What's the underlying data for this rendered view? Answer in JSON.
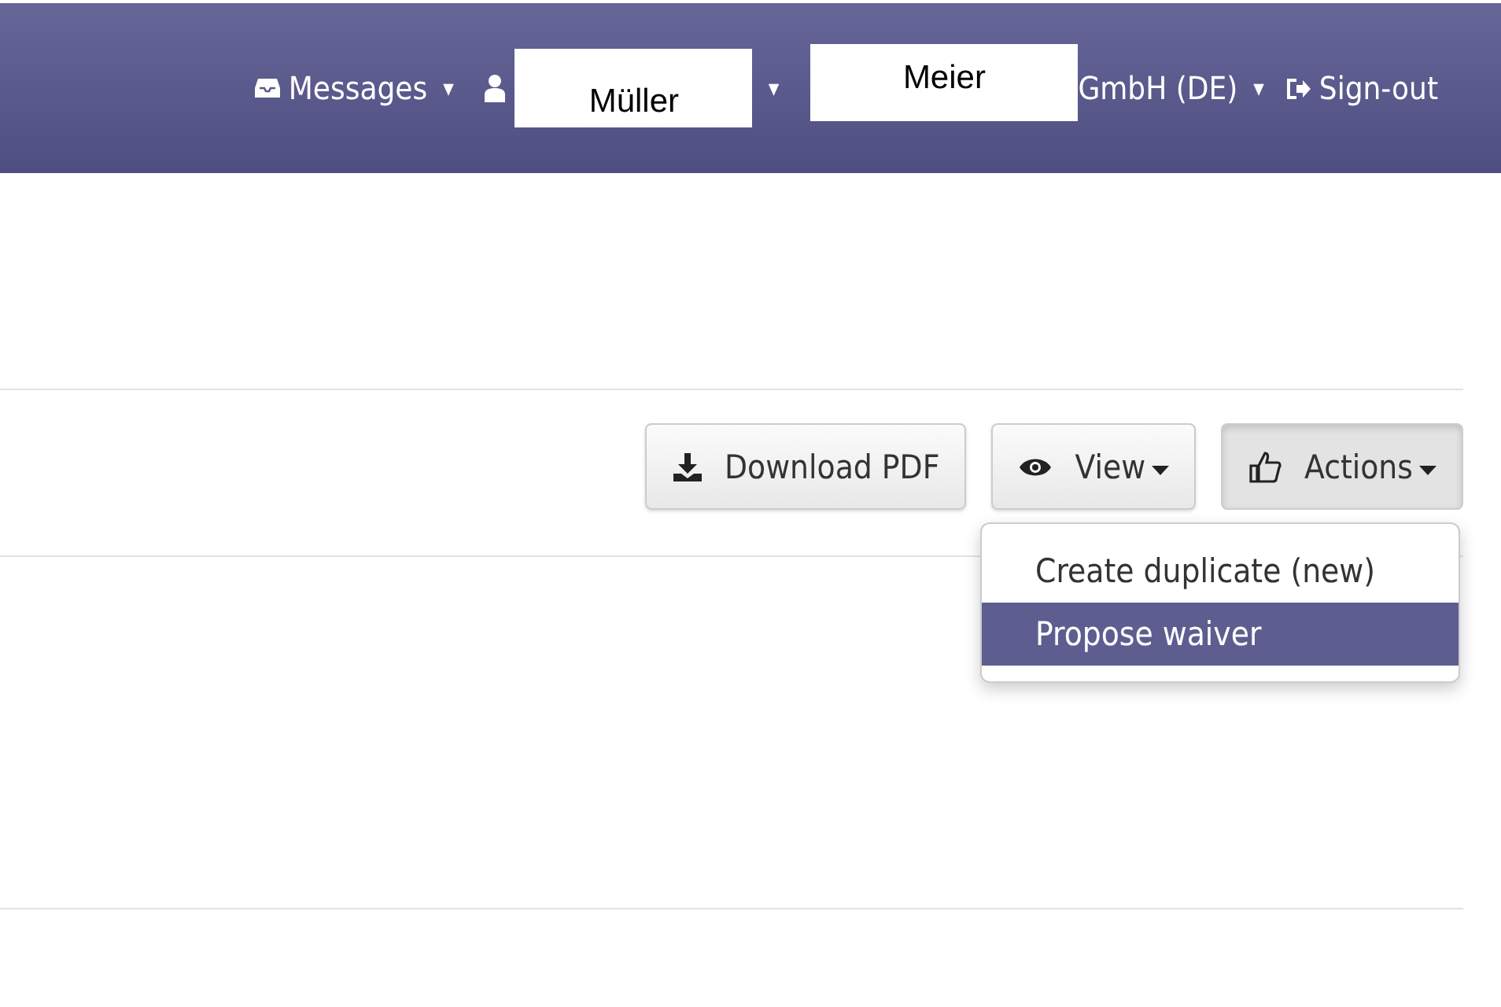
{
  "navbar": {
    "messages": {
      "label": "Messages",
      "caret": "▾"
    },
    "user": {
      "first_name": "Müller",
      "caret": "▾"
    },
    "company": {
      "name_part": "Meier",
      "suffix": "GmbH (DE)",
      "caret": "▾"
    },
    "sign_out": {
      "label": "Sign-out"
    }
  },
  "toolbar": {
    "buttons": [
      {
        "kind": "download",
        "label": "Download PDF",
        "pressed": false
      },
      {
        "kind": "view",
        "label": "View",
        "pressed": false,
        "dropdown": true
      },
      {
        "kind": "actions",
        "label": "Actions",
        "pressed": true,
        "dropdown": true
      }
    ]
  },
  "actions_menu": {
    "items": [
      {
        "label": "Create duplicate (new)",
        "selected": false
      },
      {
        "label": "Propose waiver",
        "selected": true
      }
    ]
  }
}
